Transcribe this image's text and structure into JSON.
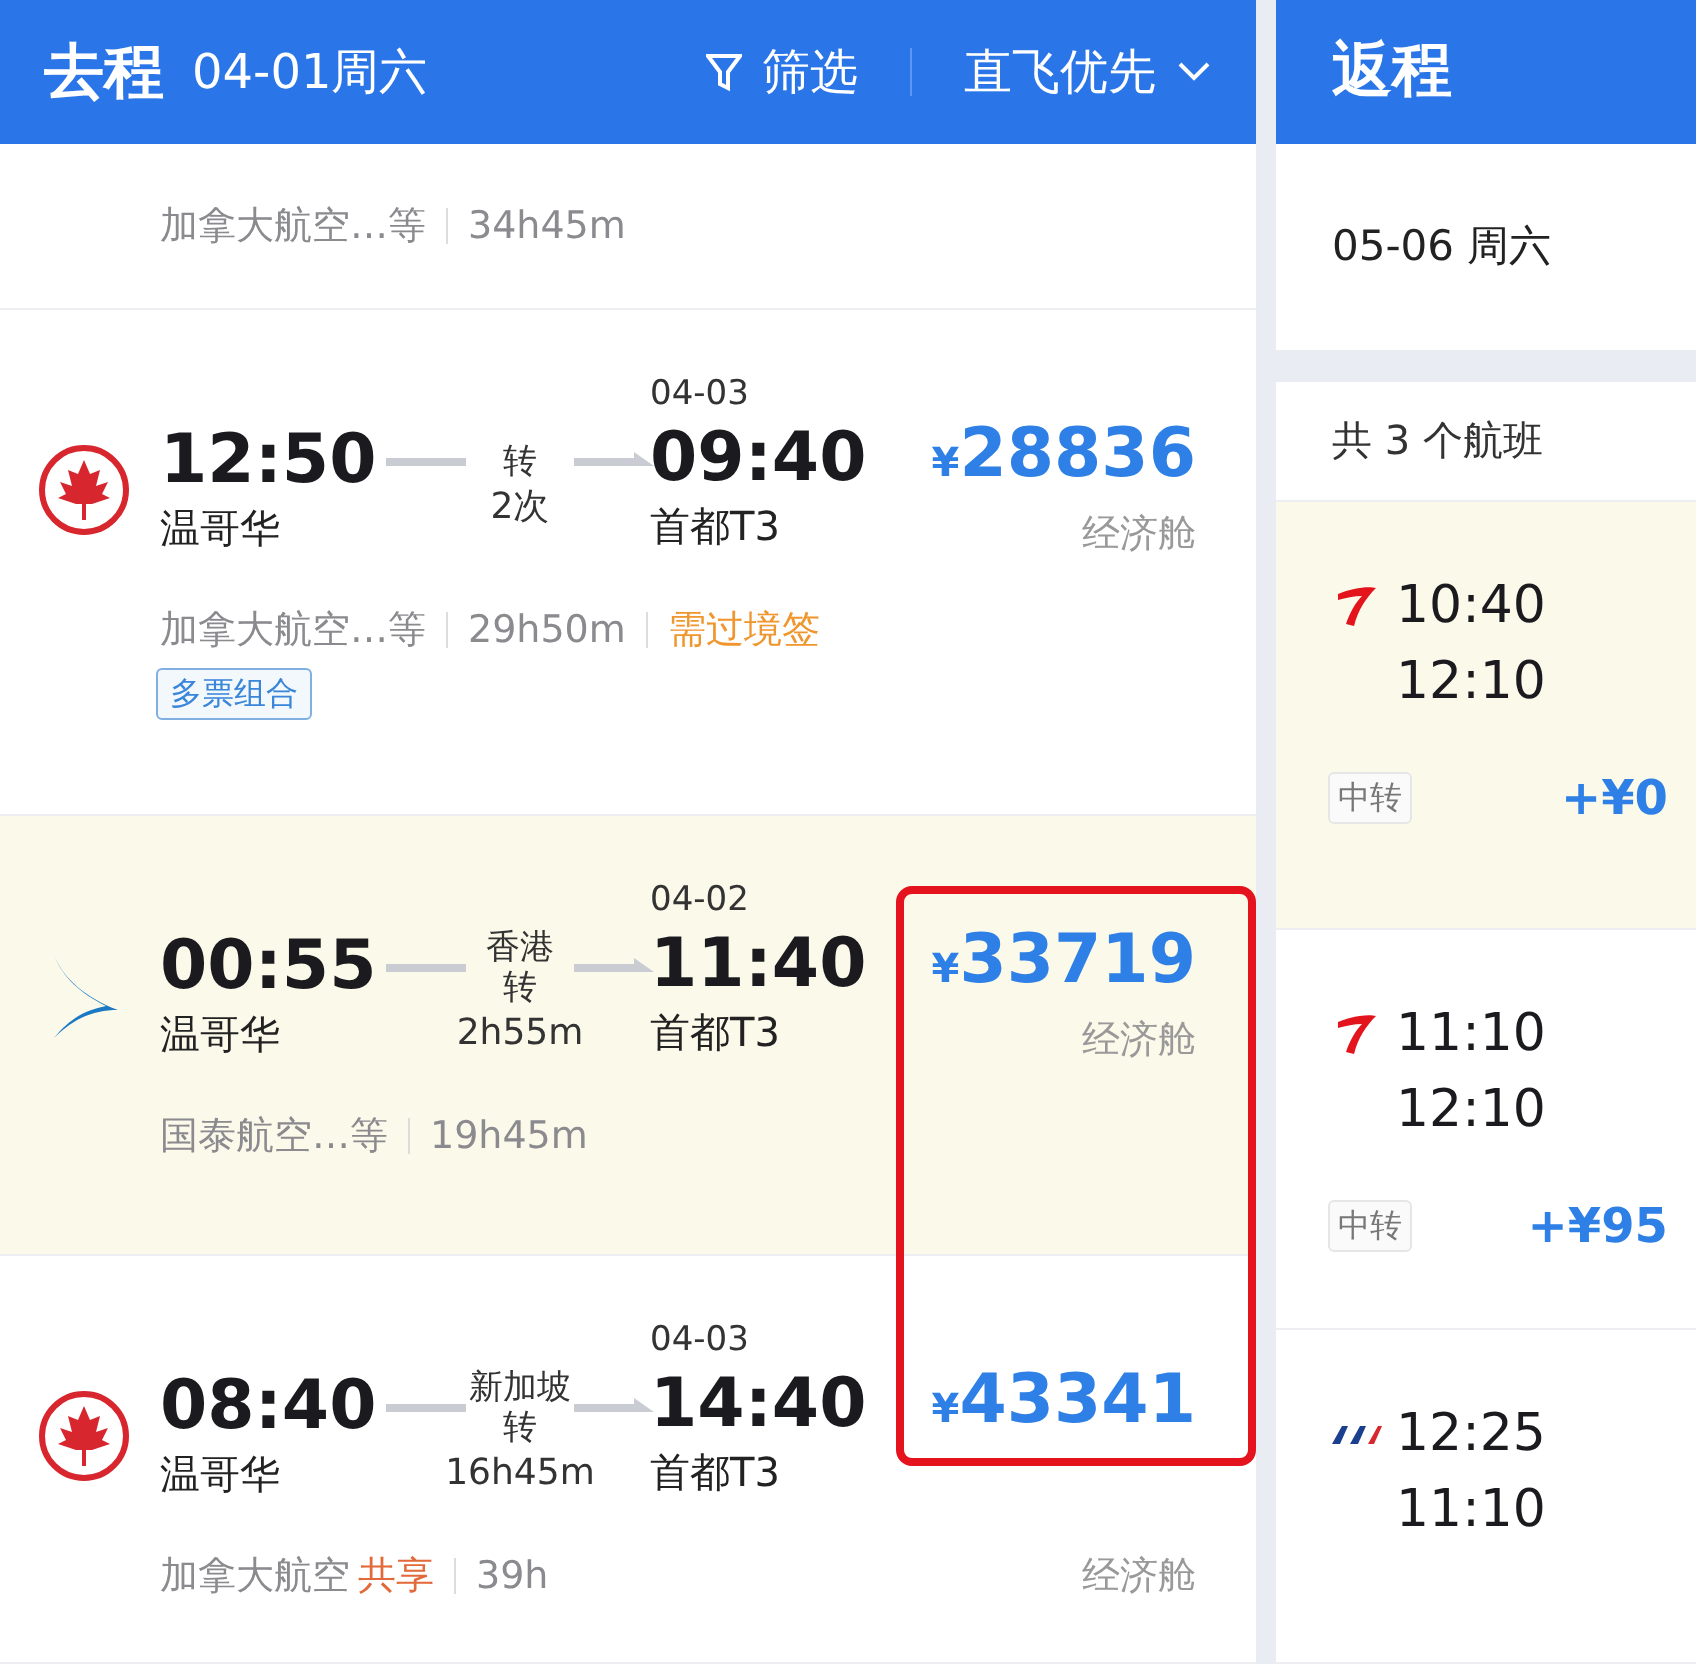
{
  "outbound": {
    "title": "去程",
    "date": "04-01周六",
    "filter": "筛选",
    "sort": "直飞优先",
    "summary": {
      "airline": "加拿大航空…等",
      "duration": "34h45m"
    },
    "flights": [
      {
        "kind": "maple",
        "dep_time": "12:50",
        "dep_city": "温哥华",
        "transfer": "转",
        "transfer_info": "2次",
        "arr_date": "04-03",
        "arr_time": "09:40",
        "arr_airport": "首都T3",
        "currency": "¥",
        "price": "28836",
        "cabin": "经济舱",
        "cabin_below": false,
        "airline": "加拿大航空…等",
        "duration": "29h50m",
        "notice": "需过境签",
        "badge": "多票组合",
        "selected": false
      },
      {
        "kind": "swoosh",
        "dep_time": "00:55",
        "dep_city": "温哥华",
        "via": "香港",
        "transfer": "转",
        "transfer_info": "2h55m",
        "arr_date": "04-02",
        "arr_time": "11:40",
        "arr_airport": "首都T3",
        "currency": "¥",
        "price": "33719",
        "cabin": "经济舱",
        "cabin_below": false,
        "airline": "国泰航空…等",
        "duration": "19h45m",
        "selected": true
      },
      {
        "kind": "maple",
        "dep_time": "08:40",
        "dep_city": "温哥华",
        "via": "新加坡",
        "transfer": "转",
        "transfer_info": "16h45m",
        "arr_date": "04-03",
        "arr_time": "14:40",
        "arr_airport": "首都T3",
        "currency": "¥",
        "price": "43341",
        "cabin": "经济舱",
        "cabin_below": true,
        "airline": "加拿大航空",
        "duration": "39h",
        "share": "共享",
        "selected": false
      }
    ]
  },
  "highlight_box": true,
  "return": {
    "title": "返程",
    "date": "05-06 周六",
    "count": "共 3 个航班",
    "flights": [
      {
        "kind": "swoosh",
        "dep_time": "10:40",
        "arr_time": "12:10",
        "tag": "中转",
        "price": "+¥0",
        "selected": true
      },
      {
        "kind": "swoosh",
        "dep_time": "11:10",
        "arr_time": "12:10",
        "tag": "中转",
        "price": "+¥95",
        "selected": false
      },
      {
        "kind": "stripes",
        "dep_time": "12:25",
        "arr_time": "11:10",
        "selected": false
      }
    ]
  }
}
